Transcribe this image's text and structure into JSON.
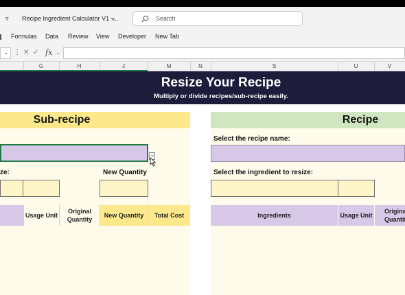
{
  "titlebar": {
    "qat_icon": "▿",
    "doc_title": "Recipe Ingredient Calculator V1 -...",
    "title_chevron": "⌄",
    "search_placeholder": "Search"
  },
  "menu": {
    "items": [
      "Formulas",
      "Data",
      "Review",
      "View",
      "Developer",
      "New Tab"
    ]
  },
  "formula_bar": {
    "fx": "fx",
    "value": ""
  },
  "columns": [
    "G",
    "H",
    "J",
    "M",
    "N",
    "S",
    "U",
    "V"
  ],
  "sheet": {
    "banner_title": "Resize Your Recipe",
    "banner_subtitle": "Multiply or divide recipes/sub-recipe easily.",
    "left": {
      "header": "Sub-recipe",
      "ingredient_label_partial": "ze:",
      "new_quantity_label": "New Quantity",
      "table_headers": [
        "Usage Unit",
        "Original Quantity",
        "New Quantity",
        "Total Cost"
      ]
    },
    "right": {
      "header": "Recipe",
      "recipe_name_label": "Select the recipe name:",
      "ingredient_label": "Select the ingredient to resize:",
      "table_headers": [
        "Ingredients",
        "Usage Unit",
        "Origina Quantit"
      ]
    }
  },
  "colors": {
    "banner": "#1d1c3b",
    "sub_header": "#fde98c",
    "recipe_header": "#cfe6c0",
    "purple_cell": "#d7c8e8",
    "panel_bg": "#fffbea"
  }
}
